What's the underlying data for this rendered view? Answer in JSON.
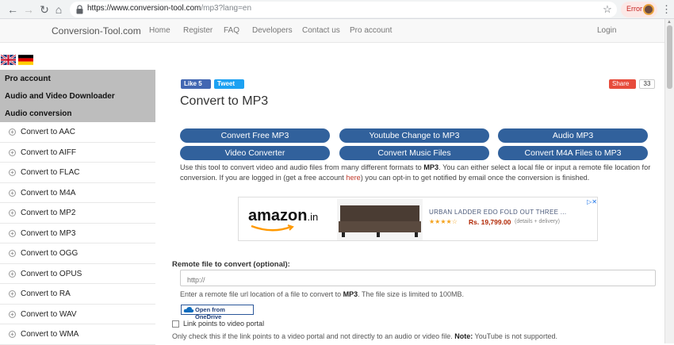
{
  "browser": {
    "url_host": "https://www.conversion-tool.com",
    "url_path": "/mp3?lang=en",
    "error_label": "Error"
  },
  "site": {
    "brand": "Conversion-Tool.com",
    "nav": [
      "Home",
      "Register",
      "FAQ",
      "Developers",
      "Contact us",
      "Pro account"
    ],
    "login": "Login"
  },
  "sidebar": {
    "headers": [
      "Pro account",
      "Audio and Video Downloader",
      "Audio conversion"
    ],
    "items": [
      "Convert to AAC",
      "Convert to AIFF",
      "Convert to FLAC",
      "Convert to M4A",
      "Convert to MP2",
      "Convert to MP3",
      "Convert to OGG",
      "Convert to OPUS",
      "Convert to RA",
      "Convert to WAV",
      "Convert to WMA"
    ]
  },
  "social": {
    "like": "Like 5",
    "tweet": "Tweet",
    "share": "Share",
    "share_count": "33"
  },
  "main": {
    "title": "Convert to MP3",
    "buttons": [
      "Convert Free MP3",
      "Youtube Change to MP3",
      "Audio MP3",
      "Video Converter",
      "Convert Music Files",
      "Convert M4A Files to MP3"
    ],
    "desc_1": "Use this tool to convert video and audio files from many different formats to ",
    "desc_bold": "MP3",
    "desc_2": ". You can either select a local file or input a remote file location for conversion. If you are logged in (get a free account ",
    "desc_link": "here",
    "desc_3": ") you can opt-in to get notified by email once the conversion is finished."
  },
  "ad": {
    "logo": "amazon",
    "logo_suffix": ".in",
    "product": "URBAN LADDER EDO FOLD OUT THREE ...",
    "stars": "★★★★☆",
    "price": "Rs. 19,799.00",
    "details": "(details + delivery)"
  },
  "remote": {
    "label": "Remote file to convert (optional):",
    "placeholder": "http://",
    "help_1": "Enter a remote file url location of a file to convert to ",
    "help_bold": "MP3",
    "help_2": ". The file size is limited to 100MB.",
    "onedrive": "Open from OneDrive",
    "checkbox_label": "Link points to video portal",
    "note_1": "Only check this if the link points to a video portal and not directly to an audio or video file. ",
    "note_bold": "Note:",
    "note_2": " YouTube is not supported."
  }
}
